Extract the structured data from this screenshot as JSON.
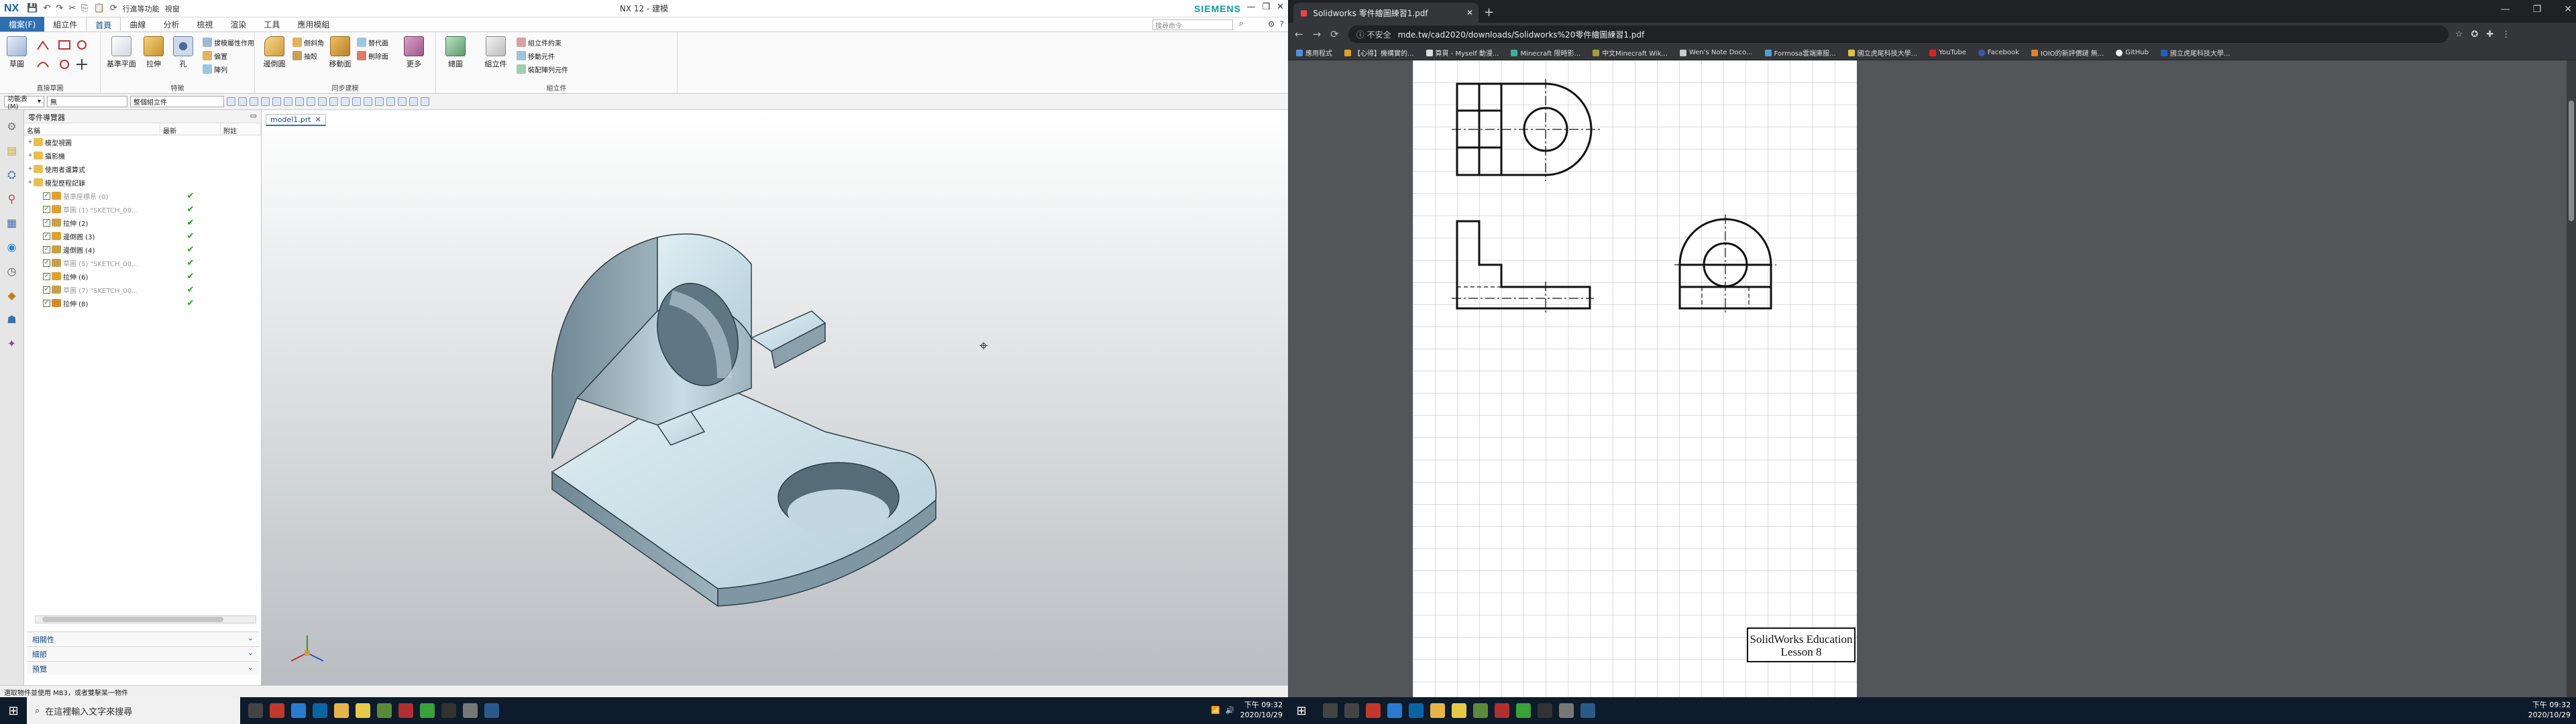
{
  "nx": {
    "logo": "NX",
    "quick_access": {
      "command_finder": "行進等功能",
      "window": "視窗"
    },
    "title": "NX 12 - 建模",
    "brand": "SIEMENS",
    "search_placeholder": "搜尋命令",
    "ribbon_tabs": [
      "檔案(F)",
      "組立件",
      "首頁",
      "曲線",
      "分析",
      "檢視",
      "渲染",
      "工具",
      "應用模組"
    ],
    "active_tab": "首頁",
    "ribbon": {
      "big_buttons": [
        "草圖",
        "基準平面",
        "拉伸",
        "孔",
        "邊倒圓",
        "移動面",
        "更多",
        "總圖",
        "組立件"
      ],
      "small_buttons": [
        "拔模屬性作用",
        "偏置",
        "陣列",
        "倒斜角",
        "替代面",
        "刪除面",
        "抽殼",
        "組立件約束",
        "移動元件",
        "裝配陣列元件"
      ],
      "groups": [
        "直接草圖",
        "特徵",
        "同步建模",
        "組立件"
      ]
    },
    "toolbar2": {
      "menu": "功能表(M)",
      "filter": "無",
      "assembly": "整個組立件"
    },
    "navigator": {
      "title": "零件導覽器",
      "columns": [
        "名稱",
        "最新",
        "附註"
      ],
      "rows": [
        {
          "label": "模型視圖",
          "state": "",
          "level": 0
        },
        {
          "label": "攝影機",
          "state": "",
          "level": 0
        },
        {
          "label": "使用者運算式",
          "state": "",
          "level": 0
        },
        {
          "label": "模型歷程記錄",
          "state": "",
          "level": 0
        },
        {
          "label": "基準座標系 (0)",
          "state": "✔",
          "level": 1,
          "greyed": true
        },
        {
          "label": "草圖 (1) \"SKETCH_00...",
          "state": "✔",
          "level": 1,
          "greyed": true
        },
        {
          "label": "拉伸 (2)",
          "state": "✔",
          "level": 1
        },
        {
          "label": "邊倒圓 (3)",
          "state": "✔",
          "level": 1
        },
        {
          "label": "邊倒圓 (4)",
          "state": "✔",
          "level": 1
        },
        {
          "label": "草圖 (5) \"SKETCH_00...",
          "state": "✔",
          "level": 1,
          "greyed": true
        },
        {
          "label": "拉伸 (6)",
          "state": "✔",
          "level": 1
        },
        {
          "label": "草圖 (7) \"SKETCH_00...",
          "state": "✔",
          "level": 1,
          "greyed": true
        },
        {
          "label": "拉伸 (8)",
          "state": "✔",
          "level": 1
        }
      ],
      "panels": [
        "相關性",
        "細節",
        "預覽"
      ]
    },
    "viewport_tab": "model1.prt",
    "status": "選取物件並使用 MB3，或者雙擊某一物件"
  },
  "chrome": {
    "tab_title": "Solidworks 零件繪圖練習1.pdf",
    "address_warning": "不安全",
    "url": "mde.tw/cad2020/downloads/Solidworks%20零件繪圖練習1.pdf",
    "bookmarks": [
      "應用程式",
      "【心得】機構實的...",
      "算貫 - Myself 動漫...",
      "Minecraft 限時影...",
      "中文Minecraft Wik...",
      "Wen's Note Doco...",
      "Formosa雲端庫服...",
      "國立虎尾科技大學...",
      "YouTube",
      "Facebook",
      "IOIO的新評價鏈 無...",
      "GitHub",
      "國立虎尾科技大學..."
    ]
  },
  "pdf": {
    "title_line1": "SolidWorks Education",
    "title_line2": "Lesson 8"
  },
  "taskbar": {
    "search_placeholder": "在這裡輸入文字來搜尋",
    "time": "下午 09:32",
    "date": "2020/10/29"
  }
}
